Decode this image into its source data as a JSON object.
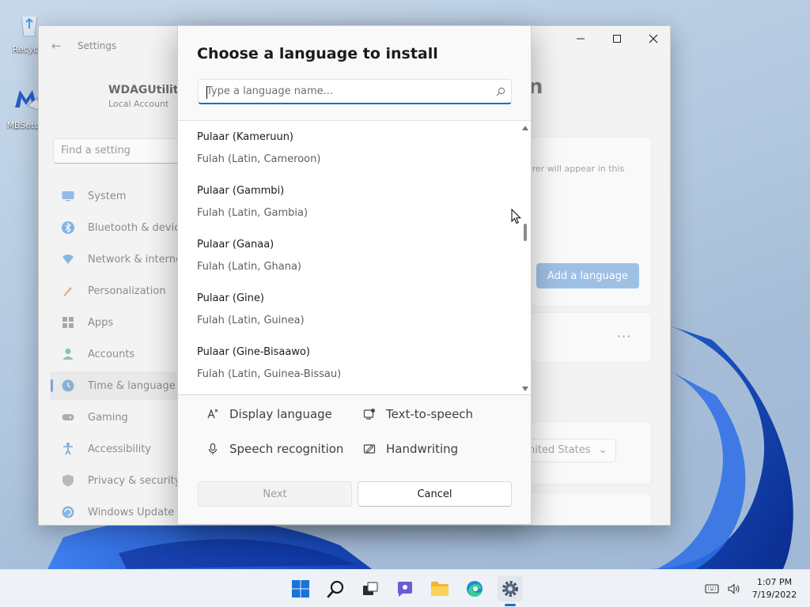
{
  "desktop": {
    "icons": [
      {
        "label": "Recycle"
      },
      {
        "label": "MBSetup"
      }
    ]
  },
  "settings_window": {
    "title": "Settings",
    "user_name": "WDAGUtilityA",
    "account_type": "Local Account",
    "find_placeholder": "Find a setting",
    "nav_items": [
      {
        "label": "System",
        "icon": "monitor-icon",
        "color": "#4a90d9"
      },
      {
        "label": "Bluetooth & device",
        "icon": "bluetooth-icon",
        "color": "#2b7fd4"
      },
      {
        "label": "Network & interne",
        "icon": "wifi-icon",
        "color": "#2f86d8"
      },
      {
        "label": "Personalization",
        "icon": "brush-icon",
        "color": "#e07a2f"
      },
      {
        "label": "Apps",
        "icon": "apps-icon",
        "color": "#6b6b7b"
      },
      {
        "label": "Accounts",
        "icon": "person-icon",
        "color": "#26a269"
      },
      {
        "label": "Time & language",
        "icon": "globe-clock-icon",
        "color": "#3b82c4"
      },
      {
        "label": "Gaming",
        "icon": "gamepad-icon",
        "color": "#777777"
      },
      {
        "label": "Accessibility",
        "icon": "accessibility-icon",
        "color": "#2c6fb8"
      },
      {
        "label": "Privacy & security",
        "icon": "shield-icon",
        "color": "#8a8a8a"
      },
      {
        "label": "Windows Update",
        "icon": "update-icon",
        "color": "#2f86d8"
      }
    ],
    "active_nav_index": 6,
    "page_title_fragment": "n",
    "hint_text": "orer will appear in this",
    "add_language_label": "Add a language",
    "region_value": "nited States"
  },
  "dialog": {
    "title": "Choose a language to install",
    "search_placeholder": "Type a language name...",
    "search_value": "",
    "languages": [
      {
        "native": "Pulaar (Kameruun)",
        "english": "Fulah (Latin, Cameroon)"
      },
      {
        "native": "Pulaar (Gammbi)",
        "english": "Fulah (Latin, Gambia)"
      },
      {
        "native": "Pulaar (Ganaa)",
        "english": "Fulah (Latin, Ghana)"
      },
      {
        "native": "Pulaar (Gine)",
        "english": "Fulah (Latin, Guinea)"
      },
      {
        "native": "Pulaar (Gine-Bisaawo)",
        "english": "Fulah (Latin, Guinea-Bissau)"
      }
    ],
    "features": [
      {
        "label": "Display language",
        "icon": "display-language-icon"
      },
      {
        "label": "Text-to-speech",
        "icon": "text-to-speech-icon"
      },
      {
        "label": "Speech recognition",
        "icon": "microphone-icon"
      },
      {
        "label": "Handwriting",
        "icon": "handwriting-icon"
      }
    ],
    "next_label": "Next",
    "cancel_label": "Cancel"
  },
  "taskbar": {
    "apps": [
      {
        "name": "start",
        "icon": "windows-start-icon"
      },
      {
        "name": "search",
        "icon": "search-icon"
      },
      {
        "name": "task-view",
        "icon": "task-view-icon"
      },
      {
        "name": "chat",
        "icon": "chat-icon"
      },
      {
        "name": "file-explorer",
        "icon": "folder-icon"
      },
      {
        "name": "edge",
        "icon": "edge-icon"
      },
      {
        "name": "settings",
        "icon": "gear-icon"
      }
    ],
    "time": "1:07 PM",
    "date": "7/19/2022"
  },
  "colors": {
    "accent": "#1a6fc4",
    "button_disabled_text": "#9c9c9c"
  }
}
